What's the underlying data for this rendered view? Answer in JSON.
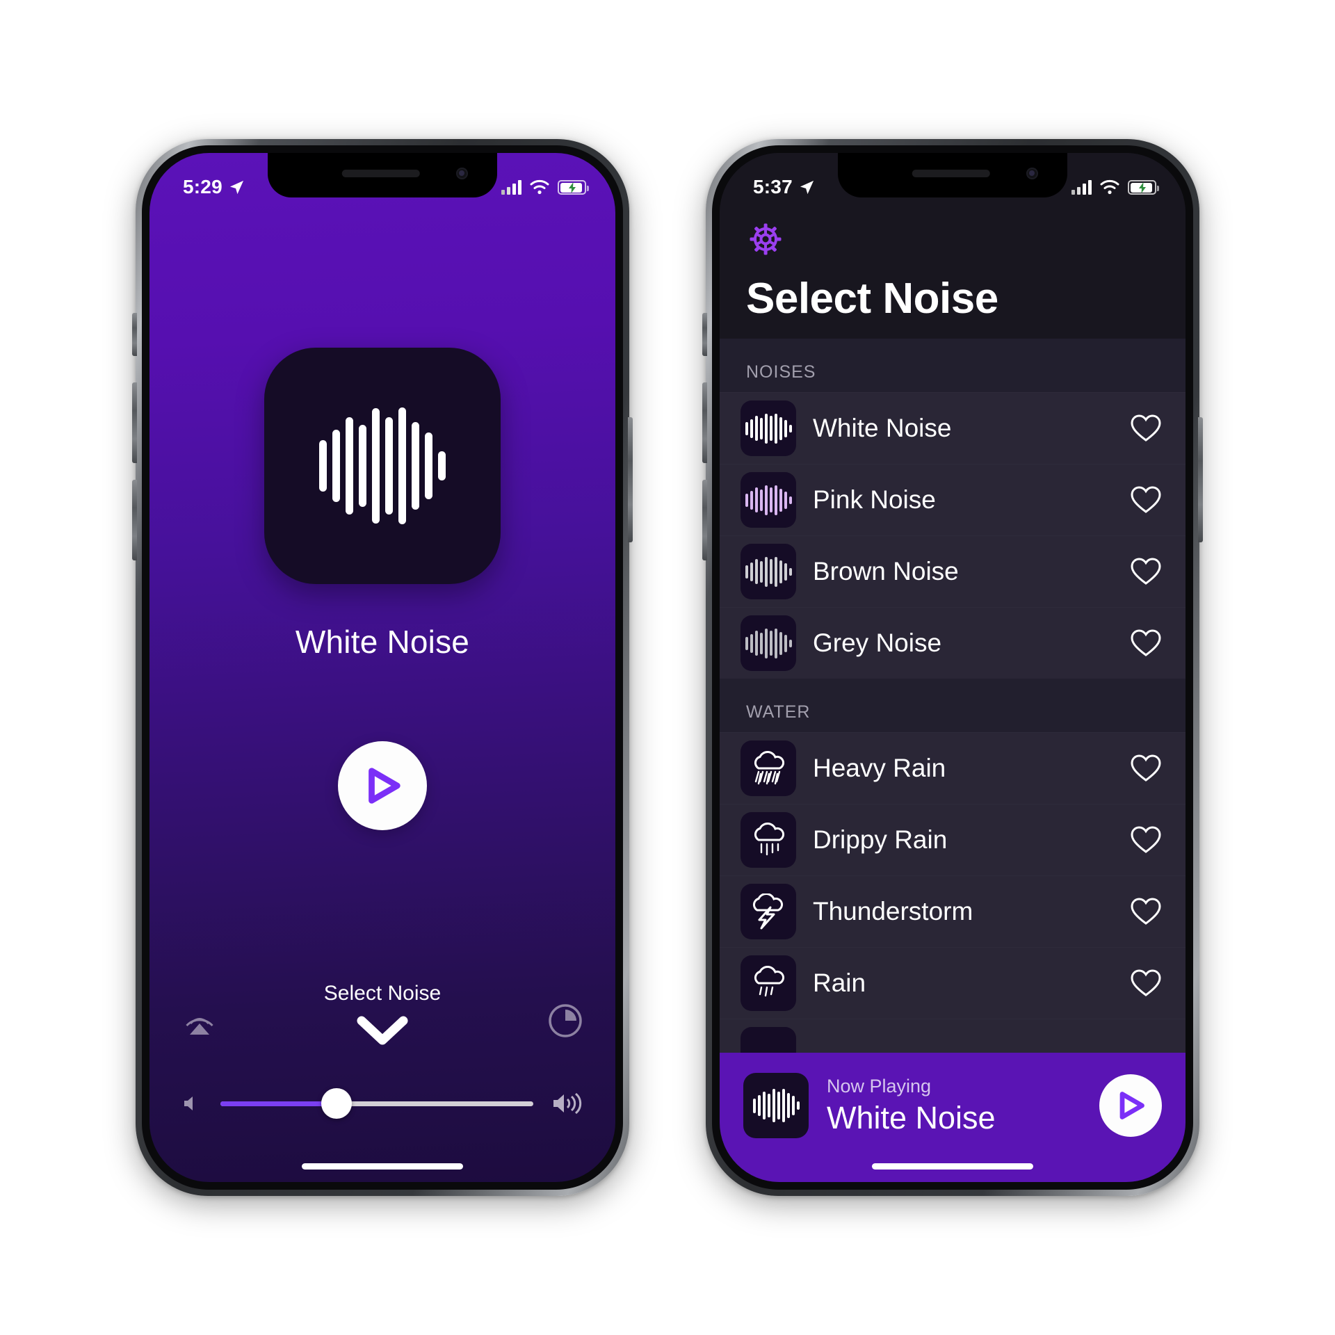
{
  "phone1": {
    "name": "player-screen",
    "status": {
      "time": "5:29",
      "location_icon": "location-arrow-icon",
      "signal_icon": "cellular-signal-icon",
      "wifi_icon": "wifi-icon",
      "battery_icon": "battery-charging-icon"
    },
    "album_art_icon": "sound-wave-icon",
    "track_title": "White Noise",
    "play_button_icon": "play-icon",
    "select_noise_label": "Select Noise",
    "chevron_icon": "chevron-down-icon",
    "airplay_icon": "airplay-icon",
    "timer_icon": "sleep-timer-icon",
    "volume": {
      "low_icon": "volume-low-icon",
      "high_icon": "volume-high-icon",
      "level_percent": 37
    }
  },
  "phone2": {
    "name": "select-noise-screen",
    "status": {
      "time": "5:37",
      "location_icon": "location-arrow-icon",
      "signal_icon": "cellular-signal-icon",
      "wifi_icon": "wifi-icon",
      "battery_icon": "battery-charging-icon"
    },
    "settings_icon": "gear-icon",
    "title": "Select Noise",
    "sections": [
      {
        "header": "NOISES",
        "items": [
          {
            "label": "White Noise",
            "icon": "sound-wave-icon",
            "icon_color": "#ffffff",
            "favorite": false,
            "favorite_icon": "heart-outline-icon"
          },
          {
            "label": "Pink Noise",
            "icon": "sound-wave-icon",
            "icon_color": "#d9b6f0",
            "favorite": false,
            "favorite_icon": "heart-outline-icon"
          },
          {
            "label": "Brown Noise",
            "icon": "sound-wave-icon",
            "icon_color": "#cfcfd4",
            "favorite": false,
            "favorite_icon": "heart-outline-icon"
          },
          {
            "label": "Grey Noise",
            "icon": "sound-wave-icon",
            "icon_color": "#bdbdc4",
            "favorite": false,
            "favorite_icon": "heart-outline-icon"
          }
        ]
      },
      {
        "header": "WATER",
        "items": [
          {
            "label": "Heavy Rain",
            "icon": "heavy-rain-icon",
            "favorite": false,
            "favorite_icon": "heart-outline-icon"
          },
          {
            "label": "Drippy Rain",
            "icon": "drippy-rain-icon",
            "favorite": false,
            "favorite_icon": "heart-outline-icon"
          },
          {
            "label": "Thunderstorm",
            "icon": "thunderstorm-icon",
            "favorite": false,
            "favorite_icon": "heart-outline-icon"
          },
          {
            "label": "Rain",
            "icon": "rain-icon",
            "favorite": false,
            "favorite_icon": "heart-outline-icon"
          }
        ]
      }
    ],
    "now_playing": {
      "label": "Now Playing",
      "title": "White Noise",
      "thumb_icon": "sound-wave-icon",
      "play_button_icon": "play-icon"
    }
  },
  "colors": {
    "brand_purple": "#5a14b4",
    "accent_purple": "#7b3ff2",
    "list_bg": "#221f2e",
    "row_bg": "#2a2636",
    "nav_bg": "#18161f",
    "thumb_bg": "#150c26"
  }
}
